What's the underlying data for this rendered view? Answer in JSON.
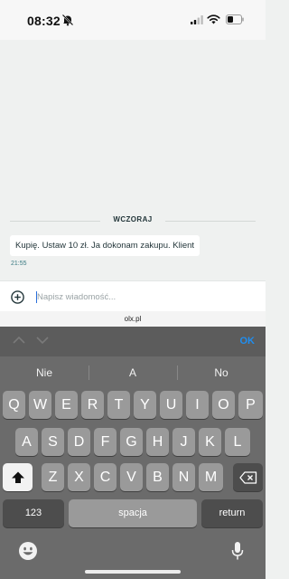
{
  "status_bar": {
    "time": "08:32",
    "icons": [
      "bell-off-icon",
      "signal-icon",
      "wifi-icon",
      "battery-icon"
    ]
  },
  "chat": {
    "date_separator": "WCZORAJ",
    "messages": [
      {
        "text": "Kupię. Ustaw 10 zł. Ja dokonam zakupu. Klient",
        "time": "21:55"
      }
    ]
  },
  "composer": {
    "placeholder": "Napisz wiadomość...",
    "value": "",
    "add_icon": "plus-circle-icon"
  },
  "browser": {
    "url": "olx.pl"
  },
  "keyboard_toolbar": {
    "ok_label": "OK",
    "accent_color": "#1f8ef1"
  },
  "keyboard": {
    "suggestions": [
      "Nie",
      "A",
      "No"
    ],
    "row1": [
      "Q",
      "W",
      "E",
      "R",
      "T",
      "Y",
      "U",
      "I",
      "O",
      "P"
    ],
    "row2": [
      "A",
      "S",
      "D",
      "F",
      "G",
      "H",
      "J",
      "K",
      "L"
    ],
    "row3": [
      "Z",
      "X",
      "C",
      "V",
      "B",
      "N",
      "M"
    ],
    "numbers_label": "123",
    "space_label": "spacja",
    "return_label": "return"
  }
}
